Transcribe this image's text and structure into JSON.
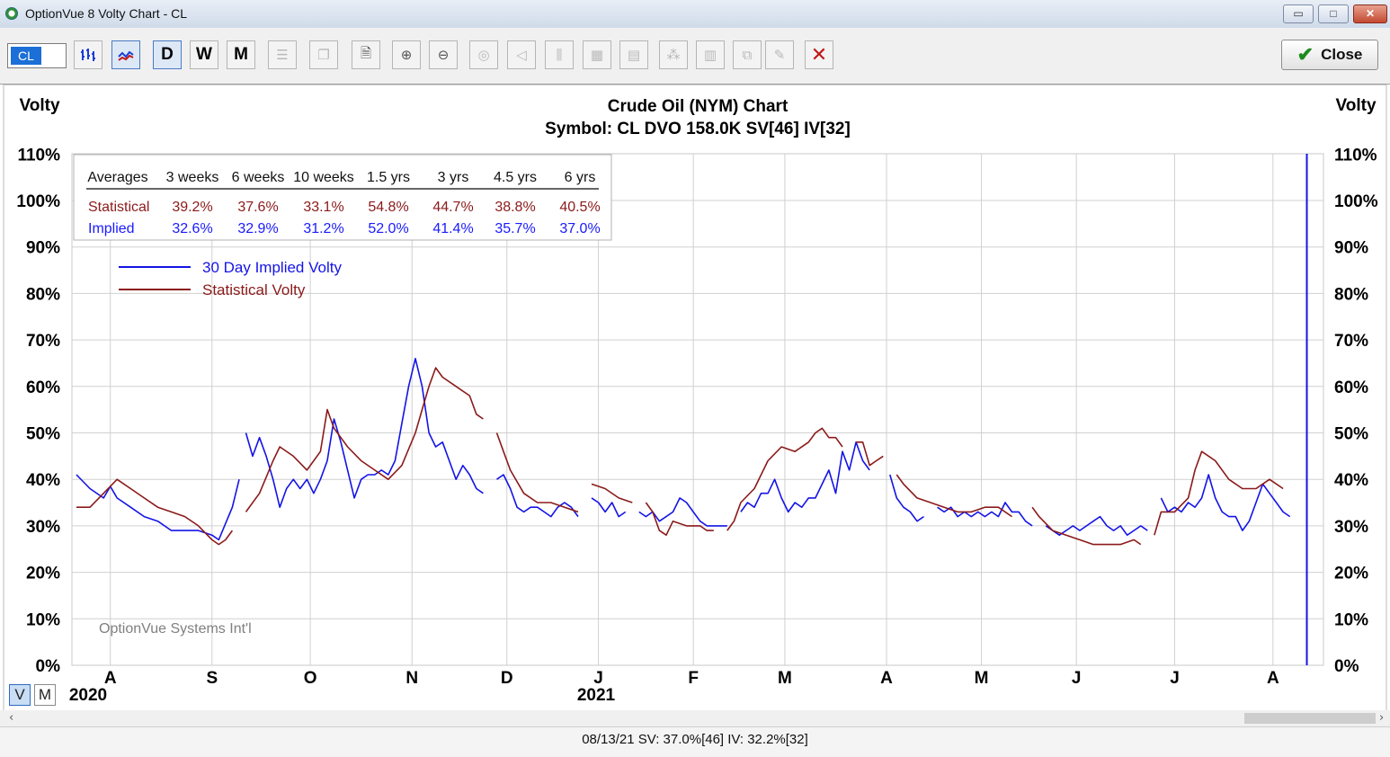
{
  "window": {
    "title": "OptionVue 8 Volty Chart - CL",
    "min_label": "▭",
    "max_label": "□",
    "close_label": "✕"
  },
  "toolbar": {
    "symbol": "CL",
    "period_d": "D",
    "period_w": "W",
    "period_m": "M",
    "close_button": "Close",
    "icons": [
      "bar-chart-icon",
      "volty-lines-icon",
      "daily",
      "weekly",
      "monthly",
      "list-icon",
      "copy-icon",
      "page-icon",
      "zoom-in-icon",
      "zoom-out-icon",
      "target-icon",
      "back-icon",
      "columns-icon",
      "grid-icon",
      "grid2-icon",
      "scatter-icon",
      "grid3-icon",
      "copy2-icon",
      "pen-icon",
      "delete-icon"
    ]
  },
  "footer": {
    "mode_v": "V",
    "mode_m": "M",
    "status": "08/13/21   SV: 37.0%[46]   IV: 32.2%[32]"
  },
  "chart_data": {
    "type": "line",
    "title": "Crude Oil (NYM) Chart",
    "subtitle": "Symbol: CL  DVO 158.0K  SV[46]  IV[32]",
    "ylabel_left": "Volty",
    "ylabel_right": "Volty",
    "ylim": [
      0,
      110
    ],
    "y_ticks": [
      "0%",
      "10%",
      "20%",
      "30%",
      "40%",
      "50%",
      "60%",
      "70%",
      "80%",
      "90%",
      "100%",
      "110%"
    ],
    "x_tick_labels": [
      "A",
      "S",
      "O",
      "N",
      "D",
      "J",
      "F",
      "M",
      "A",
      "M",
      "J",
      "J",
      "A"
    ],
    "year_labels": [
      "2020",
      "2021"
    ],
    "watermark": "OptionVue Systems Int'l",
    "grid": true,
    "averages_table": {
      "headers": [
        "Averages",
        "3 weeks",
        "6 weeks",
        "10 weeks",
        "1.5 yrs",
        "3 yrs",
        "4.5 yrs",
        "6 yrs"
      ],
      "rows": [
        {
          "label": "Statistical",
          "values": [
            "39.2%",
            "37.6%",
            "33.1%",
            "54.8%",
            "44.7%",
            "38.8%",
            "40.5%"
          ],
          "color": "#8b1a1a"
        },
        {
          "label": "Implied",
          "values": [
            "32.6%",
            "32.9%",
            "31.2%",
            "52.0%",
            "41.4%",
            "35.7%",
            "37.0%"
          ],
          "color": "#1a1aff"
        }
      ]
    },
    "series": [
      {
        "name": "30 Day Implied Volty",
        "color": "#1414e6",
        "points": [
          [
            0,
            41
          ],
          [
            2,
            38
          ],
          [
            4,
            36
          ],
          [
            5,
            38.5
          ],
          [
            6,
            36
          ],
          [
            8,
            34
          ],
          [
            10,
            32
          ],
          [
            12,
            31
          ],
          [
            14,
            29
          ],
          [
            16,
            29
          ],
          [
            18,
            29
          ],
          [
            20,
            28
          ],
          [
            21,
            27
          ],
          [
            23,
            34
          ],
          [
            24,
            40
          ],
          null,
          [
            25,
            50
          ],
          [
            26,
            45
          ],
          [
            27,
            49
          ],
          [
            28,
            45
          ],
          [
            29,
            40
          ],
          [
            30,
            34
          ],
          [
            31,
            38
          ],
          [
            32,
            40
          ],
          [
            33,
            38
          ],
          [
            34,
            40
          ],
          [
            35,
            37
          ],
          [
            36,
            40
          ],
          [
            37,
            44
          ],
          [
            38,
            53
          ],
          [
            39,
            48
          ],
          [
            40,
            42
          ],
          [
            41,
            36
          ],
          [
            42,
            40
          ],
          [
            43,
            41
          ],
          [
            44,
            41
          ],
          [
            45,
            42
          ],
          [
            46,
            41
          ],
          [
            47,
            44
          ],
          [
            48,
            52
          ],
          [
            49,
            60
          ],
          [
            50,
            66
          ],
          [
            51,
            60
          ],
          [
            52,
            50
          ],
          [
            53,
            47
          ],
          [
            54,
            48
          ],
          [
            55,
            44
          ],
          [
            56,
            40
          ],
          [
            57,
            43
          ],
          [
            58,
            41
          ],
          [
            59,
            38
          ],
          [
            60,
            37
          ],
          null,
          [
            62,
            40
          ],
          [
            63,
            41
          ],
          [
            64,
            38
          ],
          [
            65,
            34
          ],
          [
            66,
            33
          ],
          [
            67,
            34
          ],
          [
            68,
            34
          ],
          [
            69,
            33
          ],
          [
            70,
            32
          ],
          [
            71,
            34
          ],
          [
            72,
            35
          ],
          [
            73,
            34
          ],
          [
            74,
            32
          ],
          null,
          [
            76,
            36
          ],
          [
            77,
            35
          ],
          [
            78,
            33
          ],
          [
            79,
            35
          ],
          [
            80,
            32
          ],
          [
            81,
            33
          ],
          null,
          [
            83,
            33
          ],
          [
            84,
            32
          ],
          [
            85,
            33
          ],
          [
            86,
            31
          ],
          [
            87,
            32
          ],
          [
            88,
            33
          ],
          [
            89,
            36
          ],
          [
            90,
            35
          ],
          [
            91,
            33
          ],
          [
            92,
            31
          ],
          [
            93,
            30
          ],
          [
            94,
            30
          ],
          [
            95,
            30
          ],
          [
            96,
            30
          ],
          null,
          [
            98,
            33
          ],
          [
            99,
            35
          ],
          [
            100,
            34
          ],
          [
            101,
            37
          ],
          [
            102,
            37
          ],
          [
            103,
            40
          ],
          [
            104,
            36
          ],
          [
            105,
            33
          ],
          [
            106,
            35
          ],
          [
            107,
            34
          ],
          [
            108,
            36
          ],
          [
            109,
            36
          ],
          [
            110,
            39
          ],
          [
            111,
            42
          ],
          [
            112,
            37
          ],
          [
            113,
            46
          ],
          [
            114,
            42
          ],
          [
            115,
            48
          ],
          [
            116,
            44
          ],
          [
            117,
            42
          ],
          null,
          [
            120,
            41
          ],
          [
            121,
            36
          ],
          [
            122,
            34
          ],
          [
            123,
            33
          ],
          [
            124,
            31
          ],
          [
            125,
            32
          ],
          null,
          [
            127,
            34
          ],
          [
            128,
            33
          ],
          [
            129,
            34
          ],
          [
            130,
            32
          ],
          [
            131,
            33
          ],
          [
            132,
            32
          ],
          [
            133,
            33
          ],
          [
            134,
            32
          ],
          [
            135,
            33
          ],
          [
            136,
            32
          ],
          [
            137,
            35
          ],
          [
            138,
            33
          ],
          [
            139,
            33
          ],
          [
            140,
            31
          ],
          [
            141,
            30
          ],
          null,
          [
            143,
            30
          ],
          [
            144,
            29
          ],
          [
            145,
            28
          ],
          [
            146,
            29
          ],
          [
            147,
            30
          ],
          [
            148,
            29
          ],
          [
            149,
            30
          ],
          [
            150,
            31
          ],
          [
            151,
            32
          ],
          [
            152,
            30
          ],
          [
            153,
            29
          ],
          [
            154,
            30
          ],
          [
            155,
            28
          ],
          [
            156,
            29
          ],
          [
            157,
            30
          ],
          [
            158,
            29
          ],
          null,
          [
            160,
            36
          ],
          [
            161,
            33
          ],
          [
            162,
            34
          ],
          [
            163,
            33
          ],
          [
            164,
            35
          ],
          [
            165,
            34
          ],
          [
            166,
            36
          ],
          [
            167,
            41
          ],
          [
            168,
            36
          ],
          [
            169,
            33
          ],
          [
            170,
            32
          ],
          [
            171,
            32
          ],
          [
            172,
            29
          ],
          [
            173,
            31
          ],
          [
            174,
            35
          ],
          [
            175,
            39
          ],
          [
            176,
            37
          ],
          [
            177,
            35
          ],
          [
            178,
            33
          ],
          [
            179,
            32
          ]
        ]
      },
      {
        "name": "Statistical Volty",
        "color": "#8b1a1a",
        "points": [
          [
            0,
            34
          ],
          [
            2,
            34
          ],
          [
            4,
            37
          ],
          [
            6,
            40
          ],
          [
            8,
            38
          ],
          [
            10,
            36
          ],
          [
            12,
            34
          ],
          [
            14,
            33
          ],
          [
            16,
            32
          ],
          [
            18,
            30
          ],
          [
            20,
            27
          ],
          [
            21,
            26
          ],
          [
            22,
            27
          ],
          [
            23,
            29
          ],
          null,
          [
            25,
            33
          ],
          [
            27,
            37
          ],
          [
            29,
            44
          ],
          [
            30,
            47
          ],
          [
            32,
            45
          ],
          [
            34,
            42
          ],
          [
            36,
            46
          ],
          [
            37,
            55
          ],
          [
            38,
            51
          ],
          [
            40,
            47
          ],
          [
            42,
            44
          ],
          [
            44,
            42
          ],
          [
            46,
            40
          ],
          [
            48,
            43
          ],
          [
            50,
            50
          ],
          [
            51,
            55
          ],
          [
            52,
            60
          ],
          [
            53,
            64
          ],
          [
            54,
            62
          ],
          [
            56,
            60
          ],
          [
            58,
            58
          ],
          [
            59,
            54
          ],
          [
            60,
            53
          ],
          null,
          [
            62,
            50
          ],
          [
            63,
            46
          ],
          [
            64,
            42
          ],
          [
            66,
            37
          ],
          [
            68,
            35
          ],
          [
            70,
            35
          ],
          [
            72,
            34
          ],
          [
            74,
            33
          ],
          null,
          [
            76,
            39
          ],
          [
            78,
            38
          ],
          [
            80,
            36
          ],
          [
            82,
            35
          ],
          null,
          [
            84,
            35
          ],
          [
            85,
            33
          ],
          [
            86,
            29
          ],
          [
            87,
            28
          ],
          [
            88,
            31
          ],
          [
            90,
            30
          ],
          [
            92,
            30
          ],
          [
            93,
            29
          ],
          [
            94,
            29
          ],
          null,
          [
            96,
            29
          ],
          [
            97,
            31
          ],
          [
            98,
            35
          ],
          [
            100,
            38
          ],
          [
            102,
            44
          ],
          [
            104,
            47
          ],
          [
            106,
            46
          ],
          [
            108,
            48
          ],
          [
            109,
            50
          ],
          [
            110,
            51
          ],
          [
            111,
            49
          ],
          [
            112,
            49
          ],
          [
            113,
            47
          ],
          null,
          [
            115,
            48
          ],
          [
            116,
            48
          ],
          [
            117,
            43
          ],
          [
            118,
            44
          ],
          [
            119,
            45
          ],
          null,
          [
            121,
            41
          ],
          [
            122,
            39
          ],
          [
            124,
            36
          ],
          [
            126,
            35
          ],
          [
            128,
            34
          ],
          [
            130,
            33
          ],
          [
            132,
            33
          ],
          [
            134,
            34
          ],
          [
            136,
            34
          ],
          [
            138,
            32
          ],
          null,
          [
            141,
            34
          ],
          [
            142,
            32
          ],
          [
            144,
            29
          ],
          [
            146,
            28
          ],
          [
            148,
            27
          ],
          [
            150,
            26
          ],
          [
            152,
            26
          ],
          [
            154,
            26
          ],
          [
            156,
            27
          ],
          [
            157,
            26
          ],
          null,
          [
            159,
            28
          ],
          [
            160,
            33
          ],
          [
            162,
            33
          ],
          [
            164,
            36
          ],
          [
            165,
            42
          ],
          [
            166,
            46
          ],
          [
            168,
            44
          ],
          [
            170,
            40
          ],
          [
            172,
            38
          ],
          [
            174,
            38
          ],
          [
            176,
            40
          ],
          [
            178,
            38
          ]
        ]
      }
    ]
  }
}
